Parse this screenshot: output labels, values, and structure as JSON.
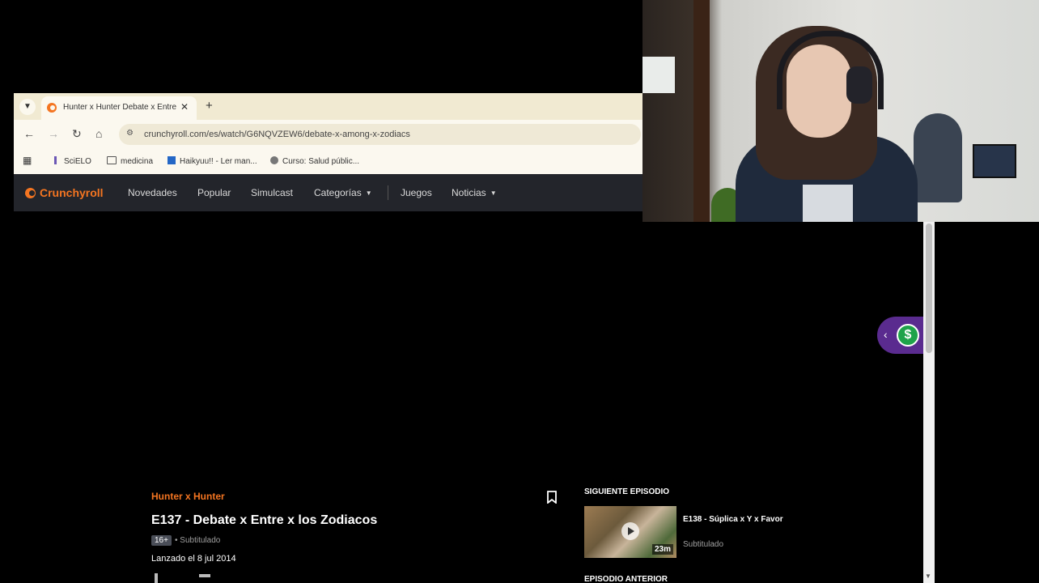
{
  "browser": {
    "tab": {
      "title": "Hunter x Hunter Debate x Entre",
      "favicon": "crunchyroll-icon"
    },
    "address": {
      "url": "crunchyroll.com/es/watch/G6NQVZEW6/debate-x-among-x-zodiacs"
    },
    "bookmarks": [
      {
        "label": "SciELO",
        "icon": "scielo-icon"
      },
      {
        "label": "medicina",
        "icon": "folder-icon"
      },
      {
        "label": "Haikyuu!! - Ler man...",
        "icon": "book-icon"
      },
      {
        "label": "Curso: Salud públic...",
        "icon": "globe-icon"
      }
    ]
  },
  "crunchyroll_nav": {
    "logo": "Crunchyroll",
    "links": [
      "Novedades",
      "Popular",
      "Simulcast",
      "Categorías",
      "Juegos",
      "Noticias"
    ]
  },
  "episode": {
    "series": "Hunter x Hunter",
    "title": "E137 - Debate x Entre x los Zodiacos",
    "rating": "16+",
    "audio": "• Subtitulado",
    "release": "Lanzado el 8 jul 2014"
  },
  "next_episode": {
    "heading": "SIGUIENTE EPISODIO",
    "title": "E138 - Súplica x Y x Favor",
    "audio": "Subtitulado",
    "duration": "23m"
  },
  "previous_episode": {
    "heading": "EPISODIO ANTERIOR"
  },
  "extension": {
    "symbol": "$"
  },
  "colors": {
    "accent": "#f47521",
    "nav_bg": "#23252b",
    "tab_strip": "#f1ead2",
    "extension": "#5a2b8f"
  }
}
